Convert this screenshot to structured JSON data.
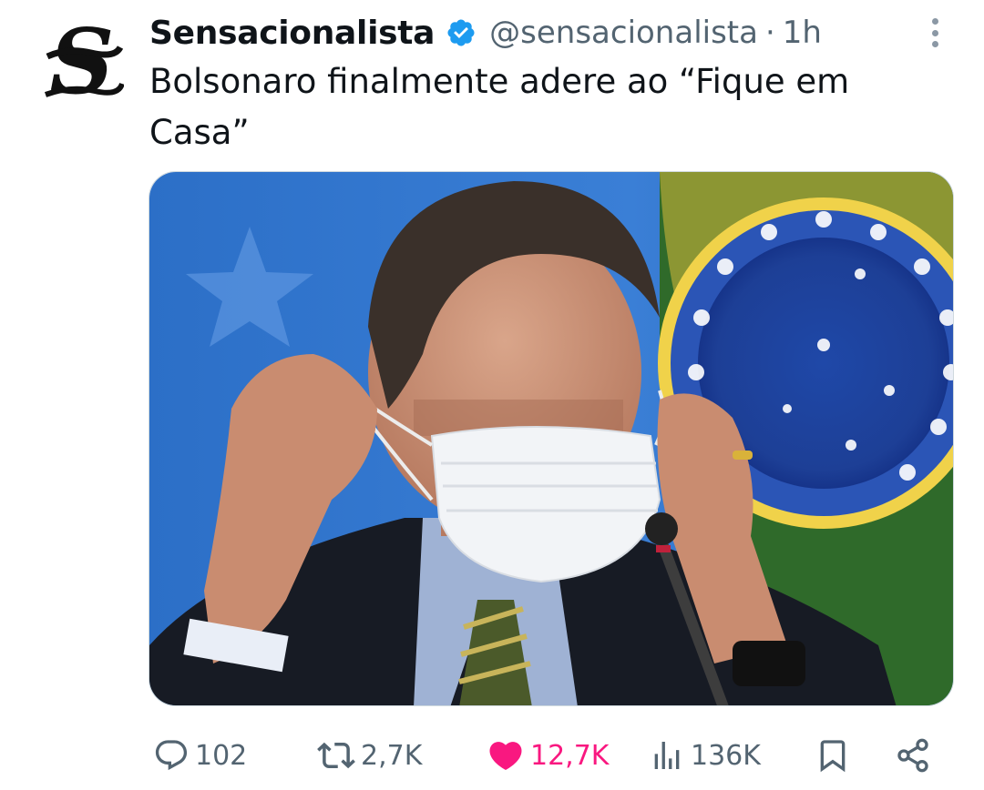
{
  "tweet": {
    "display_name": "Sensacionalista",
    "handle": "@sensacionalista",
    "separator": "·",
    "time": "1h",
    "text": "Bolsonaro finalmente adere ao “Fique em Casa”",
    "avatar_letter": "S",
    "media_icon": "photo-of-man-putting-face-mask-over-eyes"
  },
  "actions": {
    "replies": "102",
    "retweets": "2,7K",
    "likes": "12,7K",
    "views": "136K"
  },
  "colors": {
    "verified": "#1d9bf0",
    "like": "#f91880",
    "muted": "#536471",
    "text": "#0f1419"
  }
}
